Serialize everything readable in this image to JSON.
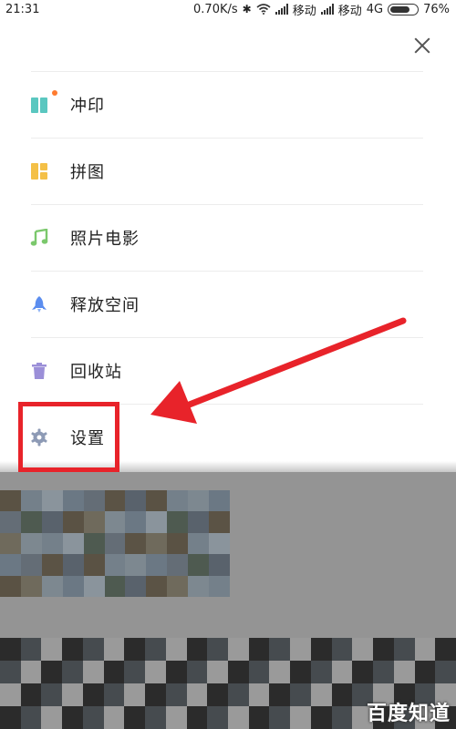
{
  "status_bar": {
    "time": "21:31",
    "speed": "0.70K/s",
    "carrier1": "移动",
    "carrier2": "移动",
    "network": "4G",
    "battery": "76%",
    "battery_level": 0.76
  },
  "menu": {
    "items": [
      {
        "label": "冲印",
        "icon": "print-icon",
        "name": "menu-item-print"
      },
      {
        "label": "拼图",
        "icon": "collage-icon",
        "name": "menu-item-collage"
      },
      {
        "label": "照片电影",
        "icon": "music-note-icon",
        "name": "menu-item-photo-movie"
      },
      {
        "label": "释放空间",
        "icon": "rocket-icon",
        "name": "menu-item-free-space"
      },
      {
        "label": "回收站",
        "icon": "trash-icon",
        "name": "menu-item-recycle-bin"
      },
      {
        "label": "设置",
        "icon": "gear-icon",
        "name": "menu-item-settings"
      }
    ]
  },
  "colors": {
    "print_icon": "#5ac7c0",
    "collage_icon": "#f4c047",
    "music_icon": "#7bc86c",
    "rocket_icon": "#5b8def",
    "trash_icon": "#9b8fd8",
    "gear_icon": "#8d9ab5",
    "annotation_red": "#e8232a",
    "badge_dot": "#ff7b2f"
  },
  "watermark": "百度知道"
}
